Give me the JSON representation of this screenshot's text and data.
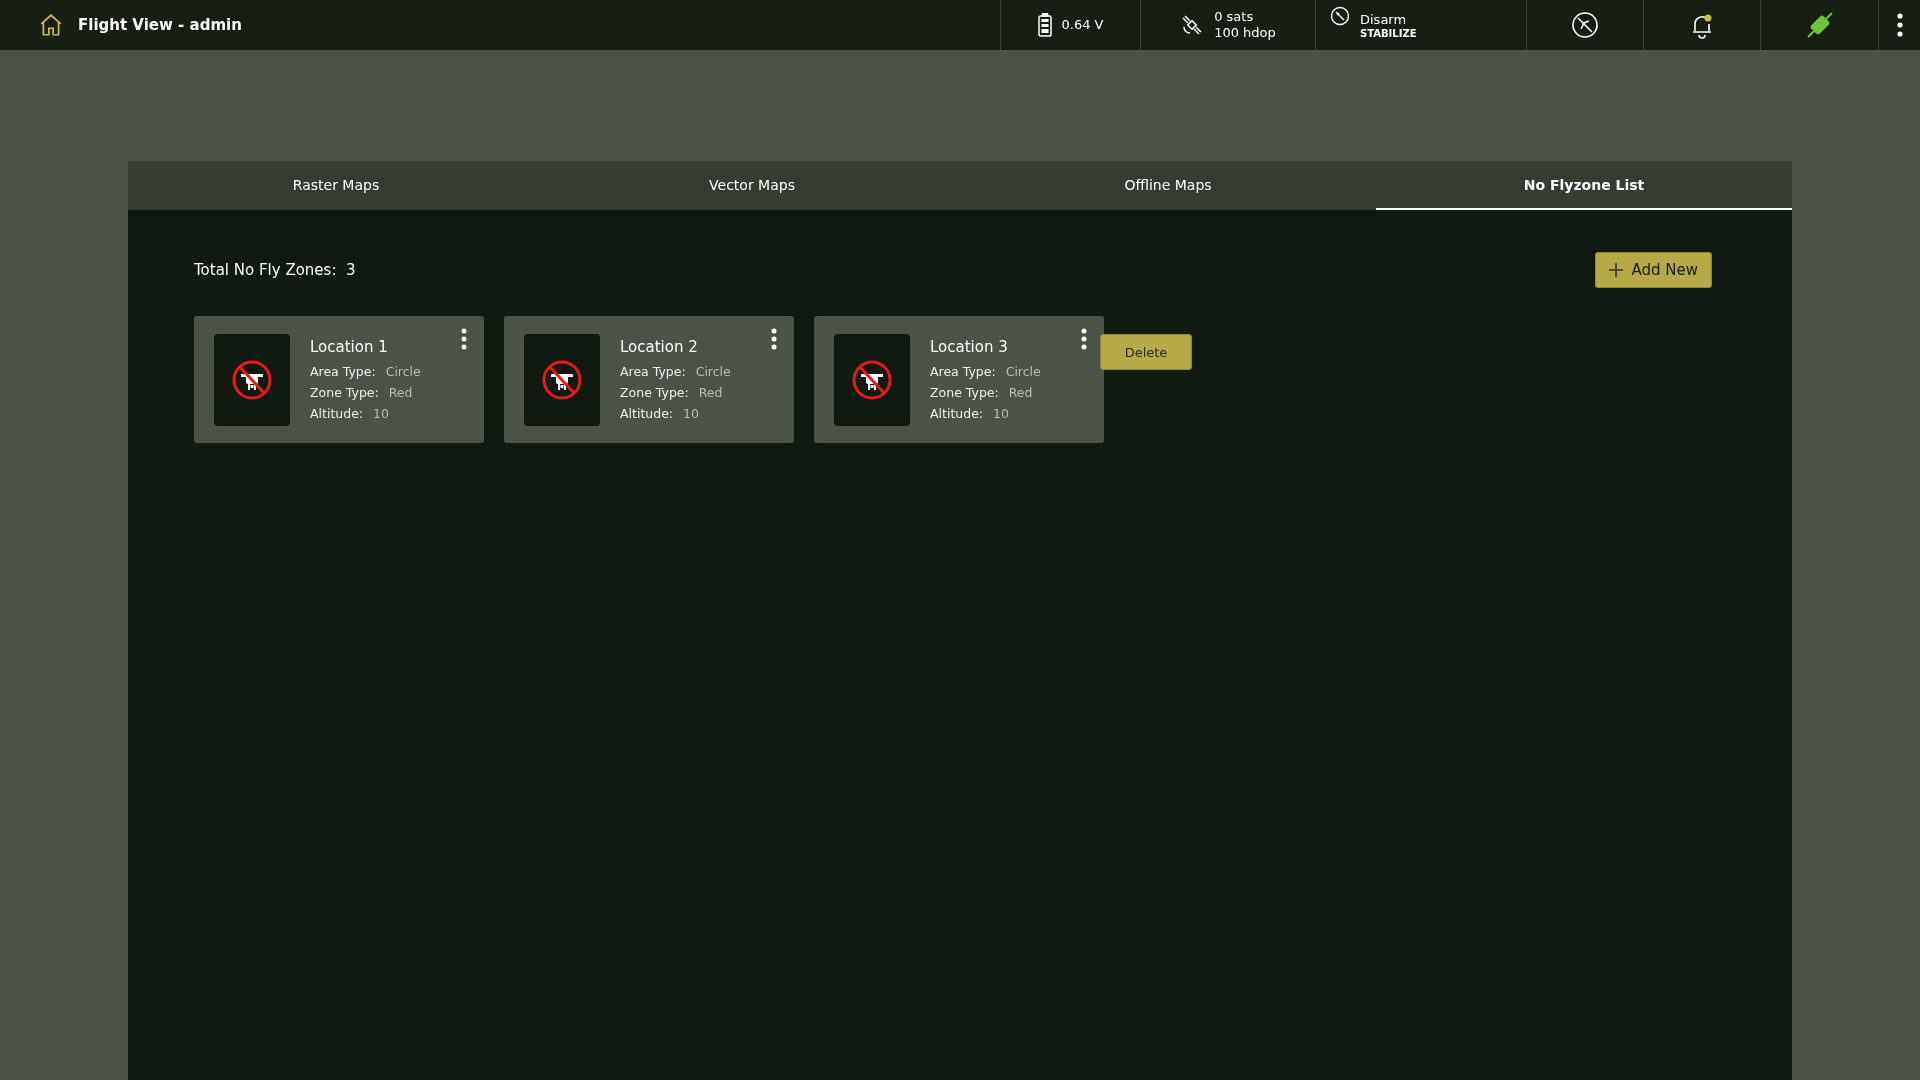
{
  "header": {
    "title": "Flight View - admin",
    "battery": "0.64 V",
    "gps": {
      "sats": "0 sats",
      "hdop": "100 hdop"
    },
    "arm": {
      "state": "Disarm",
      "mode": "STABILIZE"
    }
  },
  "tabs": [
    {
      "label": "Raster Maps",
      "selected": false
    },
    {
      "label": "Vector Maps",
      "selected": false
    },
    {
      "label": "Offline Maps",
      "selected": false
    },
    {
      "label": "No Flyzone List",
      "selected": true
    }
  ],
  "summary": {
    "label": "Total No Fly Zones:",
    "count": "3"
  },
  "add_button": "Add New",
  "zones": [
    {
      "name": "Location 1",
      "fields": [
        {
          "label": "Area Type:",
          "value": "Circle"
        },
        {
          "label": "Zone Type:",
          "value": "Red"
        },
        {
          "label": "Altitude:",
          "value": "10"
        }
      ]
    },
    {
      "name": "Location 2",
      "fields": [
        {
          "label": "Area Type:",
          "value": "Circle"
        },
        {
          "label": "Zone Type:",
          "value": "Red"
        },
        {
          "label": "Altitude:",
          "value": "10"
        }
      ]
    },
    {
      "name": "Location 3",
      "fields": [
        {
          "label": "Area Type:",
          "value": "Circle"
        },
        {
          "label": "Zone Type:",
          "value": "Red"
        },
        {
          "label": "Altitude:",
          "value": "10"
        }
      ],
      "menu": [
        "Delete"
      ]
    }
  ]
}
